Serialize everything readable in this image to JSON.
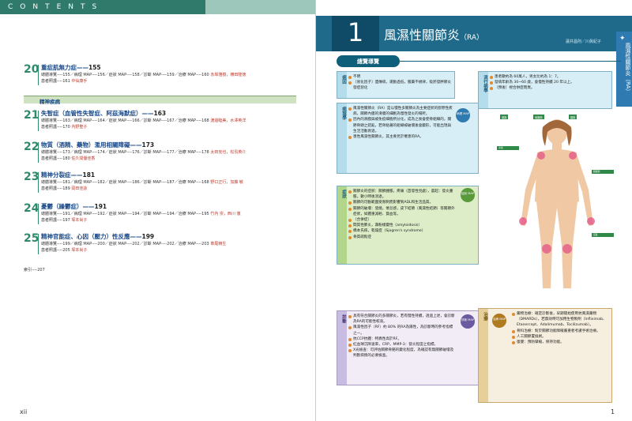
{
  "left_page": {
    "header": "CONTENTS",
    "entries": [
      {
        "num": "20",
        "title": "重症肌無力症",
        "page": "155",
        "line1": "總體導覽----155／病理 MAP----156／症狀 MAP----158／診斷 MAP----159／治療 MAP----160",
        "line1_author": "赤岸雅樹，横田隆徳",
        "line2": "患者照護----161",
        "line2_author": "中仙康手"
      },
      {
        "num": "21",
        "title": "失智症（血管性失智症、阿茲海默症）",
        "page": "163",
        "line1": "總體導覽----163／病理 MAP----164／症狀 MAP----166／診斷 MAP----167／治療 MAP----168",
        "line1_author": "渡邊睦美，水澤英洋",
        "line2": "患者照護----170",
        "line2_author": "內野聖子"
      },
      {
        "num": "22",
        "title": "物質（酒精、藥物）濫用相關障礙",
        "page": "173",
        "line1": "總體導覽----173／病理 MAP----174／症狀 MAP----176／診斷 MAP----177／治療 MAP----178",
        "line1_author": "太田克也，松島英介",
        "line2": "患者照護----180",
        "line2_author": "佐久間優佳香"
      },
      {
        "num": "23",
        "title": "精神分裂症",
        "page": "181",
        "line1": "總體導覽----181／病理 MAP----182／症狀 MAP----186／診斷 MAP----187／治療 MAP----168",
        "line1_author": "野口正行，加藤 敏",
        "line2": "患者照護----189",
        "line2_author": "岡田佳詠"
      },
      {
        "num": "24",
        "title": "憂鬱（躁鬱症）",
        "page": "191",
        "line1": "總體導覽----191／病理 MAP----192／症狀 MAP----194／診斷 MAP----194／治療 MAP----195",
        "line1_author": "竹內 崇，西川 徹",
        "line2": "患者照護----197",
        "line2_author": "塚本尚子"
      },
      {
        "num": "25",
        "title": "精神官能症、心因（壓力）性反應",
        "page": "199",
        "line1": "總體導覽----199／病理 MAP----200／症狀 MAP----202／診斷 MAP----202／治療 MAP----203",
        "line1_author": "車尾賴生",
        "line2": "患者照護----205",
        "line2_author": "塚本尚子"
      }
    ],
    "section_label": "精神疾病",
    "index_line": "索引----207",
    "folio": "xii"
  },
  "right_page": {
    "chapter_num": "1",
    "chapter_title": "風濕性關節炎",
    "chapter_abbr": "（RA）",
    "author": "蓮井昌則／川眞紀子",
    "side_tab": "風濕性關節炎（RA）",
    "overview_label": "總覽導覽",
    "map_badges": [
      "病理 MAP",
      "症狀 MAP",
      "診斷 MAP",
      "治療 MAP"
    ],
    "panels": {
      "cause": {
        "label": "病因",
        "items": [
          "不明",
          "〔易化因子〕遺傳病，運動過低，服藥不規律，吸菸發胖節炎發症惡化"
        ]
      },
      "epidemiology": {
        "label": "流行病學",
        "items": [
          "患者數約為 60萬人，男女比約為 1：7。",
          "發病年齡為 30~60 歲，會慢性持續 20 年以上。",
          "〔預後〕視合併症而異。"
        ]
      },
      "pathology": {
        "label": "病理學",
        "items": [
          "風濕性關節炎（RA）是以慢性多關節炎為主要症狀的膠原性疾病，關節內膜的滑膜的細胞為慢性發炎的場所。",
          "因內的滑膜與被免疫細胞所分化，成為之後會使骨組織的，關節骨頭之錯亂，若骨粘著的組織被破壞後會變形，可能出現與生活活動衰退。",
          "患性風濕性關節炎，其主要見於罹患的RA。"
        ]
      },
      "symptoms": {
        "label": "症狀",
        "items": [
          "關節炎的症狀：關節腫脹，疼痛（首發性見處），晨起：發炎腫脹，數小時後消退。",
          "關節的可動範圍受限制而影響到ADL和生活品質。",
          "關節的破壞：發燒，倦怠感，皮下結節（風濕性結節）等關節外症狀，如體重減輕、貧血等。",
          "〔合併症〕",
          "間質性肺炎，澱粉樣變性（amyloidosis）",
          "橋本氏病，乾燥症（Sjogren's syndrome）",
          "骨質疏鬆症"
        ]
      },
      "diagnosis": {
        "label": "診斷",
        "items": [
          "具有符合關節炎的多關節炎，若有慢性持續，透過上述，會診斷為RA的可能性較高。",
          "風濕性因子（RF）約 80% 的RA為陽性，為診斷時的參考指標之一。",
          "抗CCP抗體：特異性高於RF。",
          "紅血球沉降速率，CRP，MMP-3：發炎程度之指標。",
          "X光檢查：可評估關節骨骼的變化程度，為確認有無關節破壞及判斷病情的必要檢查。"
        ]
      },
      "treatment": {
        "label": "治療",
        "items": [
          "藥物治療：確定診斷後，早期開始使用抗風濕藥物（DMARDs），若無效時可加用生物製劑（Infliximab、Etanercept、Adalimumab、Tocilizumab）。",
          "骨科治療：對於關節功能障礙嚴重者考慮手術治療。",
          "人工關節置換術。",
          "復健：預防攣縮，保持功能。"
        ]
      }
    },
    "figure_tags": [
      "頭痛",
      "肩關節",
      "頸椎",
      "手指",
      "膝關節",
      "足趾"
    ],
    "folio": "1"
  },
  "colors": {
    "teal": "#2f7a6a",
    "header_blue": "#1f6a8a",
    "panel_blue": "#d7eef6",
    "panel_green": "#dcedc8",
    "accent_red": "#c0392b",
    "skin": "#f1c8a4"
  }
}
